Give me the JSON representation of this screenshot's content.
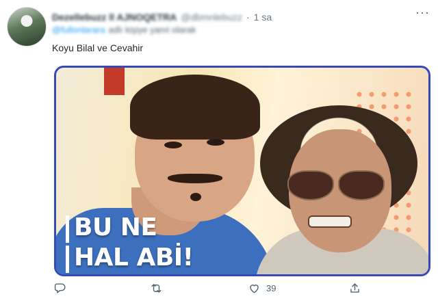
{
  "tweet": {
    "author_name": "Dezellebuzz ll AJNOQETRA",
    "author_handle": "@dbmnlebuzz",
    "time": "1 sa",
    "more_label": "···",
    "replying_handle": "@fullonlarara",
    "replying_text": "adlı kişiye yanıt olarak",
    "text": "Koyu Bilal ve Cevahir",
    "image_caption_line1": "BU NE",
    "image_caption_line2": "HAL ABİ!",
    "actions": {
      "reply_count": "",
      "retweet_count": "",
      "like_count": "39",
      "share_count": ""
    },
    "icons": [
      "reply-icon",
      "retweet-icon",
      "heart-icon",
      "share-icon"
    ],
    "colors": {
      "media_border": "#3549b8",
      "link": "#1d9bf0",
      "muted": "#536471"
    }
  }
}
